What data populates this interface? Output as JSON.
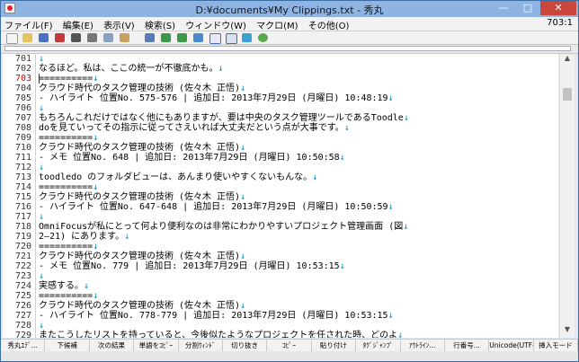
{
  "window": {
    "title": "D:¥documents¥My Clippings.txt - 秀丸",
    "minimize": "—",
    "maximize": "□",
    "close": "✕"
  },
  "menubar": {
    "items": [
      "ファイル(F)",
      "編集(E)",
      "表示(V)",
      "検索(S)",
      "ウィンドウ(W)",
      "マクロ(M)",
      "その他(O)"
    ],
    "position": "703:1"
  },
  "toolbar": {
    "icons": [
      "new-file-icon",
      "open-folder-icon",
      "save-icon",
      "reload-icon",
      "undo-icon",
      "cut-icon",
      "copy-icon",
      "paste-icon",
      "search-icon",
      "search-up-icon",
      "search-down-icon",
      "replace-icon",
      "grep-icon",
      "window-icon",
      "compare-icon",
      "help-icon"
    ]
  },
  "editor": {
    "current_line": "703",
    "lines": [
      {
        "num": "701",
        "text": ""
      },
      {
        "num": "702",
        "text": "なるほど。私は、ここの統一が不徹底かも。"
      },
      {
        "num": "703",
        "text": "=========="
      },
      {
        "num": "704",
        "text": "クラウド時代のタスク管理の技術 (佐々木 正悟)"
      },
      {
        "num": "705",
        "text": "- ハイライト 位置No. 575-576 | 追加日: 2013年7月29日 (月曜日) 10:48:19"
      },
      {
        "num": "706",
        "text": ""
      },
      {
        "num": "707",
        "text": "もちろんこれだけではなく他にもありますが、要は中央のタスク管理ツールであるToodle"
      },
      {
        "num": "708",
        "text": "doを見ていってその指示に従ってさえいれば大丈夫だという点が大事です。"
      },
      {
        "num": "709",
        "text": "=========="
      },
      {
        "num": "710",
        "text": "クラウド時代のタスク管理の技術 (佐々木 正悟)"
      },
      {
        "num": "711",
        "text": "- メモ 位置No. 648 | 追加日: 2013年7月29日 (月曜日) 10:50:58"
      },
      {
        "num": "712",
        "text": ""
      },
      {
        "num": "713",
        "text": "toodledo のフォルダビューは、あんまり使いやすくないもんな。"
      },
      {
        "num": "714",
        "text": "=========="
      },
      {
        "num": "715",
        "text": "クラウド時代のタスク管理の技術 (佐々木 正悟)"
      },
      {
        "num": "716",
        "text": "- ハイライト 位置No. 647-648 | 追加日: 2013年7月29日 (月曜日) 10:50:59"
      },
      {
        "num": "717",
        "text": ""
      },
      {
        "num": "718",
        "text": "OmniFocusが私にとって何より便利なのは非常にわかりやすいプロジェクト管理画面 (図"
      },
      {
        "num": "719",
        "text": "2―21) にあります。"
      },
      {
        "num": "720",
        "text": "=========="
      },
      {
        "num": "721",
        "text": "クラウド時代のタスク管理の技術 (佐々木 正悟)"
      },
      {
        "num": "722",
        "text": "- メモ 位置No. 779 | 追加日: 2013年7月29日 (月曜日) 10:53:15"
      },
      {
        "num": "723",
        "text": ""
      },
      {
        "num": "724",
        "text": "実感する。"
      },
      {
        "num": "725",
        "text": "=========="
      },
      {
        "num": "726",
        "text": "クラウド時代のタスク管理の技術 (佐々木 正悟)"
      },
      {
        "num": "727",
        "text": "- ハイライト 位置No. 778-779 | 追加日: 2013年7月29日 (月曜日) 10:53:15"
      },
      {
        "num": "728",
        "text": ""
      },
      {
        "num": "729",
        "text": "またこうしたリストを持っていると、今後似たようなプロジェクトを任された時、どのよ"
      }
    ]
  },
  "function_keys": [
    "秀丸ｴﾃﾞ...",
    "下候補",
    "次の結果",
    "単語をｺﾋﾟｰ",
    "分割ｳｨﾝﾄﾞ",
    "切り抜き",
    "ｺﾋﾟｰ",
    "貼り付け",
    "ﾀｸﾞｼﾞｬﾝﾌﾟ",
    "ｱｳﾄﾗｲﾝ...",
    "行番号...",
    "Unicode(UTF-8)",
    "挿入モード"
  ],
  "eol_mark": "↓"
}
